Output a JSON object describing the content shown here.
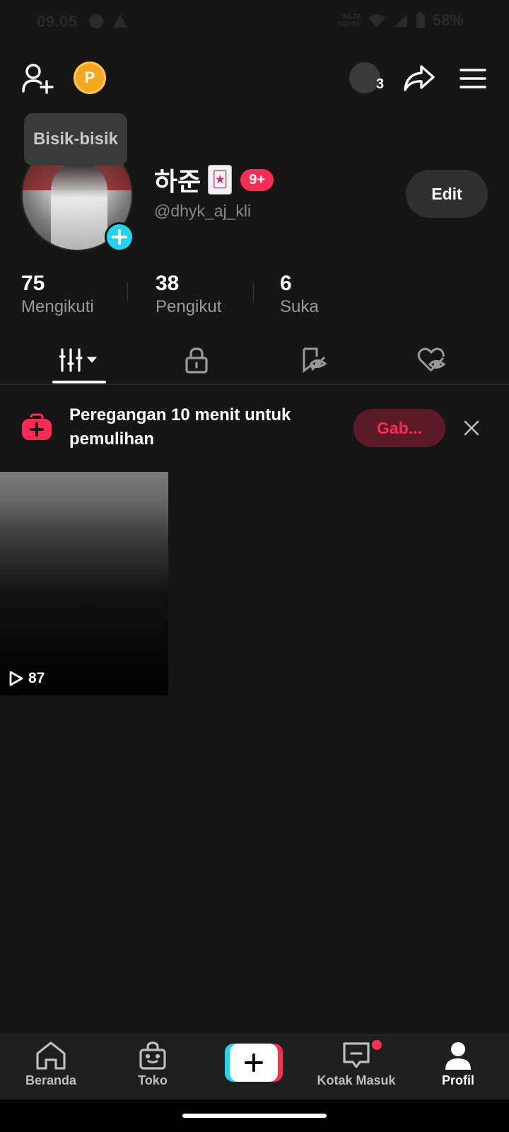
{
  "status_bar": {
    "time": "09.05",
    "net_speed_value": "86,32",
    "net_speed_unit": "KB/dtk",
    "battery": "58%"
  },
  "top_bar": {
    "coin_letter": "P",
    "story_count": "3"
  },
  "tooltip": "Bisik-bisik",
  "profile": {
    "name": "하준",
    "card_emoji": "🃏",
    "notif_badge": "9+",
    "handle": "@dhyk_aj_kli",
    "edit_label": "Edit"
  },
  "stats": [
    {
      "value": "75",
      "label": "Mengikuti"
    },
    {
      "value": "38",
      "label": "Pengikut"
    },
    {
      "value": "6",
      "label": "Suka"
    }
  ],
  "promo": {
    "text": "Peregangan 10 menit untuk pemulihan",
    "join_label": "Gab..."
  },
  "videos": [
    {
      "views": "87"
    }
  ],
  "bottom_nav": {
    "home": "Beranda",
    "shop": "Toko",
    "inbox": "Kotak Masuk",
    "profile": "Profil"
  },
  "colors": {
    "background": "#161616",
    "accent_red": "#fe2c55",
    "accent_cyan": "#20d5ec",
    "coin": "#f5a623"
  }
}
